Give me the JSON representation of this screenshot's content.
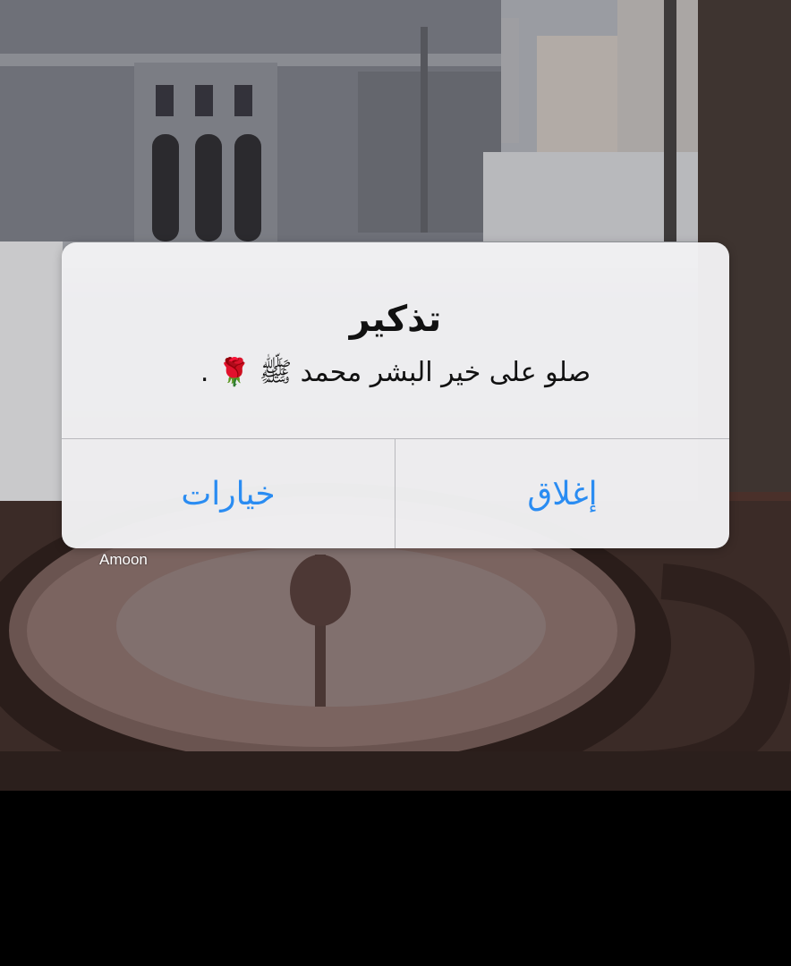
{
  "alert": {
    "title": "تذكير",
    "message": "صلو على خير البشر محمد ﷺ 🌹 .",
    "options_button": "خيارات",
    "close_button": "إغلاق"
  },
  "watermark": "Amoon",
  "colors": {
    "button_text": "#2a8cf2",
    "alert_background": "#f2f2f4",
    "divider": "#b9b9bd"
  }
}
